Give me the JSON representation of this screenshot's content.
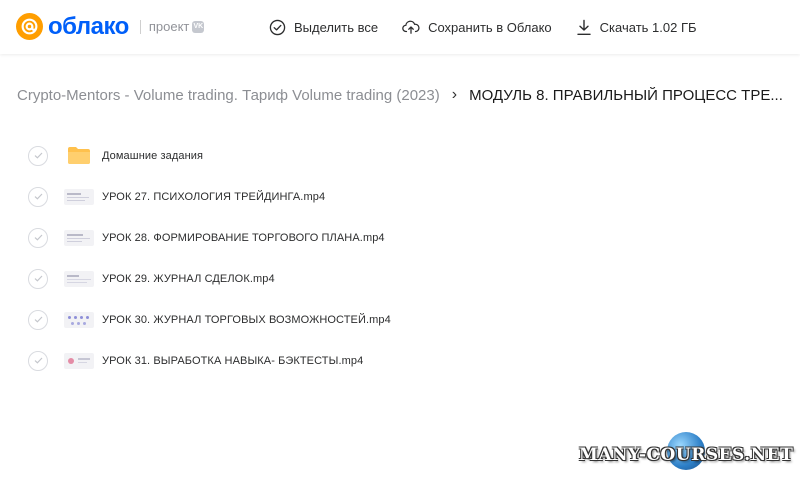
{
  "header": {
    "logo_text": "облако",
    "project_label": "проект",
    "vk_badge": "VK",
    "actions": [
      {
        "label": "Выделить все",
        "icon": "check-circle-icon"
      },
      {
        "label": "Сохранить в Облако",
        "icon": "cloud-upload-icon"
      },
      {
        "label": "Скачать 1.02 ГБ",
        "icon": "download-icon"
      }
    ]
  },
  "breadcrumb": {
    "parent": "Crypto-Mentors - Volume trading. Тариф Volume trading (2023)",
    "separator": "›",
    "current": "МОДУЛЬ 8. ПРАВИЛЬНЫЙ ПРОЦЕСС ТРЕ..."
  },
  "files": [
    {
      "name": "Домашние задания",
      "type": "folder"
    },
    {
      "name": "УРОК 27. ПСИХОЛОГИЯ ТРЕЙДИНГА.mp4",
      "type": "video"
    },
    {
      "name": "УРОК 28. ФОРМИРОВАНИЕ ТОРГОВОГО ПЛАНА.mp4",
      "type": "video"
    },
    {
      "name": "УРОК 29. ЖУРНАЛ СДЕЛОК.mp4",
      "type": "video"
    },
    {
      "name": "УРОК 30. ЖУРНАЛ ТОРГОВЫХ ВОЗМОЖНОСТЕЙ.mp4",
      "type": "video"
    },
    {
      "name": "УРОК 31. ВЫРАБОТКА НАВЫКА- БЭКТЕСТЫ.mp4",
      "type": "video"
    }
  ],
  "watermark": "MANY-COURSES.NET",
  "colors": {
    "brand_blue": "#005ff9",
    "brand_orange": "#ff9e00",
    "folder": "#ffc14d",
    "muted": "#8c8e93"
  }
}
